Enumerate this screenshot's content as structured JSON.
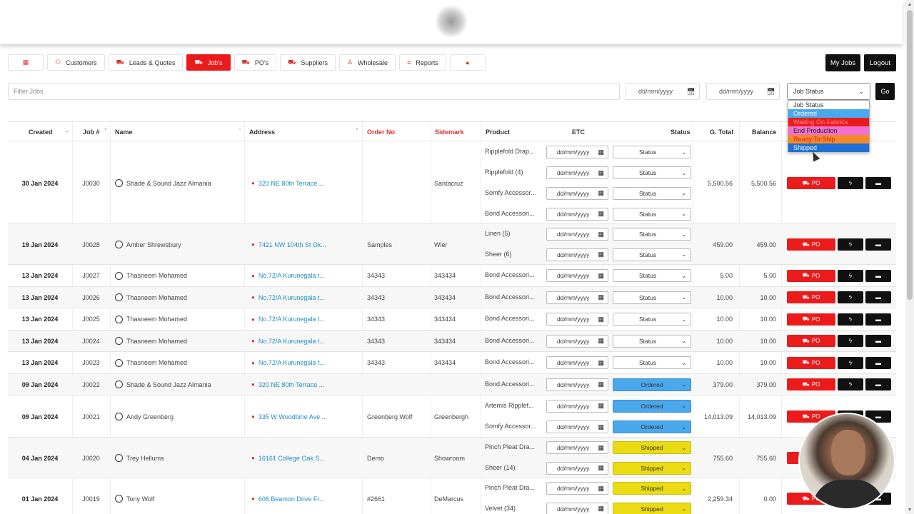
{
  "nav": {
    "calendar_icon": "calendar-icon",
    "items": [
      {
        "label": "Customers",
        "icon": "users-icon"
      },
      {
        "label": "Leads & Quotes",
        "icon": "car-icon"
      },
      {
        "label": "Job's",
        "icon": "car-icon",
        "active": true
      },
      {
        "label": "PO's",
        "icon": "car-icon"
      },
      {
        "label": "Suppliers",
        "icon": "truck-icon"
      },
      {
        "label": "Wholesale",
        "icon": "person-icon"
      },
      {
        "label": "Reports",
        "icon": "chart-icon"
      }
    ],
    "map_icon": "map-pin-icon",
    "my_jobs": "My Jobs",
    "logout": "Logout"
  },
  "filters": {
    "placeholder": "Filter Jobs",
    "date_from": "dd/mm/yyyy",
    "date_to": "dd/mm/yyyy",
    "job_status": "Job Status",
    "go": "Go"
  },
  "status_dropdown": {
    "options": [
      {
        "label": "Job Status",
        "bg": "#ffffff",
        "color": "#333333"
      },
      {
        "label": "Ordered",
        "bg": "#4aa8ec",
        "color": "#ffffff"
      },
      {
        "label": "Waiting On Fabrics",
        "bg": "#ec1b1b",
        "color": "#ff8a8a"
      },
      {
        "label": "End Production",
        "bg": "#f36fd2",
        "color": "#222222"
      },
      {
        "label": "Ready To Ship",
        "bg": "#f38b28",
        "color": "#ec1b1b"
      },
      {
        "label": "Shipped",
        "bg": "#1e6fd6",
        "color": "#ffffff"
      }
    ]
  },
  "table": {
    "headers": {
      "created": "Created",
      "job": "Job #",
      "name": "Name",
      "address": "Address",
      "order_no": "Order No",
      "sidemark": "Sidemark",
      "product": "Product",
      "etc": "ETC",
      "status": "Status",
      "g_total": "G. Total",
      "balance": "Balance"
    },
    "date_placeholder": "dd/mm/yyyy",
    "status_placeholder": "Status",
    "po_label": "PO",
    "rows": [
      {
        "created": "30 Jan 2024",
        "job": "J0030",
        "name": "Shade & Sound Jazz Almania",
        "address": "320 NE 80th Terrace ...",
        "order_no": "",
        "sidemark": "Santacruz",
        "g_total": "5,500.56",
        "balance": "5,500.56",
        "items": [
          {
            "product": "Ripplefold Drap...",
            "status": "Status"
          },
          {
            "product": "Ripplefold (4)",
            "status": "Status"
          },
          {
            "product": "Somfy Accessor...",
            "status": "Status"
          },
          {
            "product": "Bond Accessori...",
            "status": "Status"
          }
        ]
      },
      {
        "created": "19 Jan 2024",
        "job": "J0028",
        "name": "Amber Shrewsbury",
        "address": "7421 NW 104th St Ok...",
        "order_no": "Samples",
        "sidemark": "Wier",
        "g_total": "459.00",
        "balance": "459.00",
        "items": [
          {
            "product": "Linen (5)",
            "status": "Status"
          },
          {
            "product": "Sheer (6)",
            "status": "Status"
          }
        ]
      },
      {
        "created": "13 Jan 2024",
        "job": "J0027",
        "name": "Thasneem Mohamed",
        "address": "No.72/A Kurunegala t...",
        "order_no": "34343",
        "sidemark": "343434",
        "g_total": "5.00",
        "balance": "5.00",
        "items": [
          {
            "product": "Bond Accessori...",
            "status": "Status"
          }
        ]
      },
      {
        "created": "13 Jan 2024",
        "job": "J0026",
        "name": "Thasneem Mohamed",
        "address": "No.72/A Kurunegala t...",
        "order_no": "34343",
        "sidemark": "343434",
        "g_total": "10.00",
        "balance": "10.00",
        "items": [
          {
            "product": "Bond Accessori...",
            "status": "Status"
          }
        ]
      },
      {
        "created": "13 Jan 2024",
        "job": "J0025",
        "name": "Thasneem Mohamed",
        "address": "No.72/A Kurunegala t...",
        "order_no": "34343",
        "sidemark": "343434",
        "g_total": "10.00",
        "balance": "10.00",
        "items": [
          {
            "product": "Bond Accessori...",
            "status": "Status"
          }
        ]
      },
      {
        "created": "13 Jan 2024",
        "job": "J0024",
        "name": "Thasneem Mohamed",
        "address": "No.72/A Kurunegala t...",
        "order_no": "34343",
        "sidemark": "343434",
        "g_total": "10.00",
        "balance": "10.00",
        "items": [
          {
            "product": "Bond Accessori...",
            "status": "Status"
          }
        ]
      },
      {
        "created": "13 Jan 2024",
        "job": "J0023",
        "name": "Thasneem Mohamed",
        "address": "No.72/A Kurunegala t...",
        "order_no": "34343",
        "sidemark": "343434",
        "g_total": "10.00",
        "balance": "10.00",
        "items": [
          {
            "product": "Bond Accessori...",
            "status": "Status"
          }
        ]
      },
      {
        "created": "09 Jan 2024",
        "job": "J0022",
        "name": "Shade & Sound Jazz Almania",
        "address": "320 NE 80th Terrace ...",
        "order_no": "",
        "sidemark": "",
        "g_total": "379.00",
        "balance": "379.00",
        "items": [
          {
            "product": "Bond Accessori...",
            "status": "Ordered"
          }
        ]
      },
      {
        "created": "09 Jan 2024",
        "job": "J0021",
        "name": "Andy Greenberg",
        "address": "335 W Woodbine Ave ...",
        "order_no": "Greenberg Wolf",
        "sidemark": "Greenbergh",
        "g_total": "14,013.09",
        "balance": "14,013.09",
        "items": [
          {
            "product": "Artemis Ripplef...",
            "status": "Ordered"
          },
          {
            "product": "Somfy Accessor...",
            "status": "Ordered"
          }
        ]
      },
      {
        "created": "04 Jan 2024",
        "job": "J0020",
        "name": "Trey Hellums",
        "address": "16161 College Oak S...",
        "order_no": "Demo",
        "sidemark": "Showroom",
        "g_total": "755.60",
        "balance": "755.60",
        "items": [
          {
            "product": "Pinch Pleat Dra...",
            "status": "Shipped"
          },
          {
            "product": "Sheer (14)",
            "status": "Shipped"
          }
        ]
      },
      {
        "created": "01 Jan 2024",
        "job": "J0019",
        "name": "Tony Wolf",
        "address": "606 Beamon Drive Fr...",
        "order_no": "#2661",
        "sidemark": "DeMarcus",
        "g_total": "2,259.34",
        "balance": "0.00",
        "items": [
          {
            "product": "Pinch Pleat Dra...",
            "status": "Shipped"
          },
          {
            "product": "Velvet (34)",
            "status": "Shipped"
          }
        ]
      }
    ]
  }
}
